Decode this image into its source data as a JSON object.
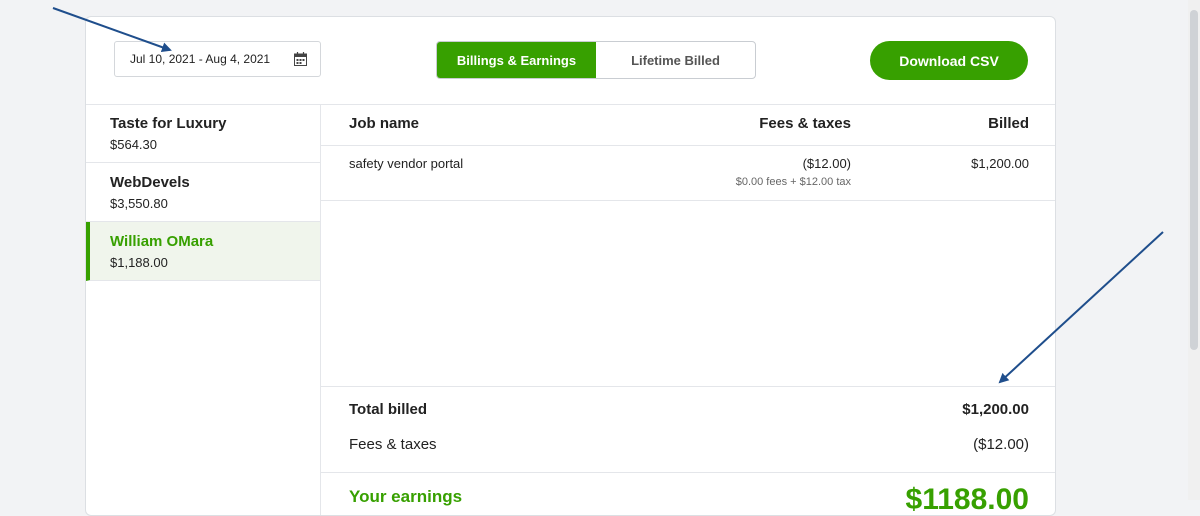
{
  "date_picker": {
    "value": "Jul 10, 2021 - Aug 4, 2021",
    "icon": "calendar-icon"
  },
  "tabs": [
    {
      "label": "Billings & Earnings",
      "active": true
    },
    {
      "label": "Lifetime Billed",
      "active": false
    }
  ],
  "download_button": {
    "label": "Download CSV"
  },
  "clients": [
    {
      "name": "Taste for Luxury",
      "amount": "$564.30"
    },
    {
      "name": "WebDevels",
      "amount": "$3,550.80"
    },
    {
      "name": "William OMara",
      "amount": "$1,188.00",
      "active": true
    }
  ],
  "table": {
    "headers": {
      "job": "Job name",
      "fees": "Fees & taxes",
      "billed": "Billed"
    },
    "rows": [
      {
        "job": "safety vendor portal",
        "fees": "($12.00)",
        "fees_detail": "$0.00 fees + $12.00 tax",
        "billed": "$1,200.00"
      }
    ]
  },
  "totals": {
    "billed_label": "Total billed",
    "billed_value": "$1,200.00",
    "fees_label": "Fees & taxes",
    "fees_value": "($12.00)"
  },
  "earnings": {
    "label": "Your earnings",
    "value": "$1188.00"
  },
  "colors": {
    "accent": "#37a000",
    "annotation_arrow": "#1f4e8c"
  }
}
